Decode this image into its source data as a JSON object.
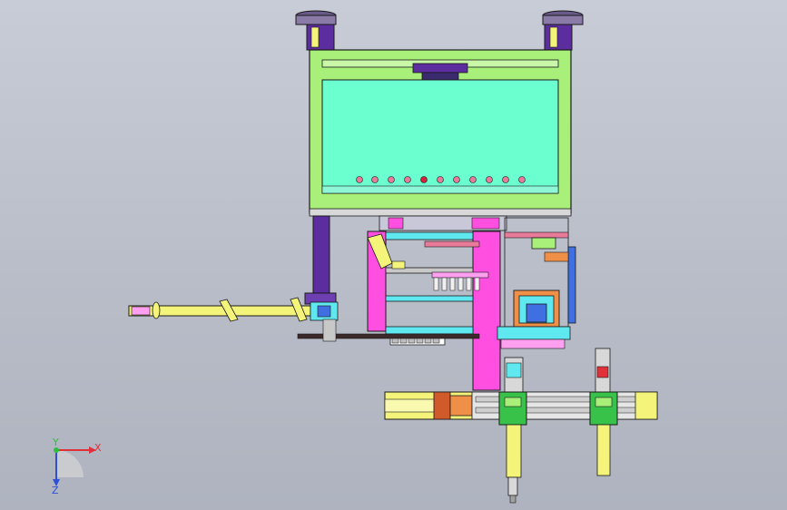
{
  "view": {
    "type": "cad-assembly-front-view",
    "background_top": "#c8ccd6",
    "background_bottom": "#aeb3bf"
  },
  "triad": {
    "x_label": "X",
    "y_label": "Y",
    "z_label": "Z",
    "x_color": "#e0303a",
    "y_color": "#2fbf3a",
    "z_color": "#2f4fd8"
  },
  "palette": {
    "frame": "#a8f07a",
    "panel": "#6bffcf",
    "magenta": "#ff4fe0",
    "purple": "#5b2d9e",
    "yellow": "#f4f47a",
    "green_block": "#39c24a",
    "orange": "#f09048",
    "blue": "#3f6fe0",
    "cyan": "#5fe8f0",
    "steel": "#b8b8b8",
    "outline": "#1a1a1a"
  }
}
